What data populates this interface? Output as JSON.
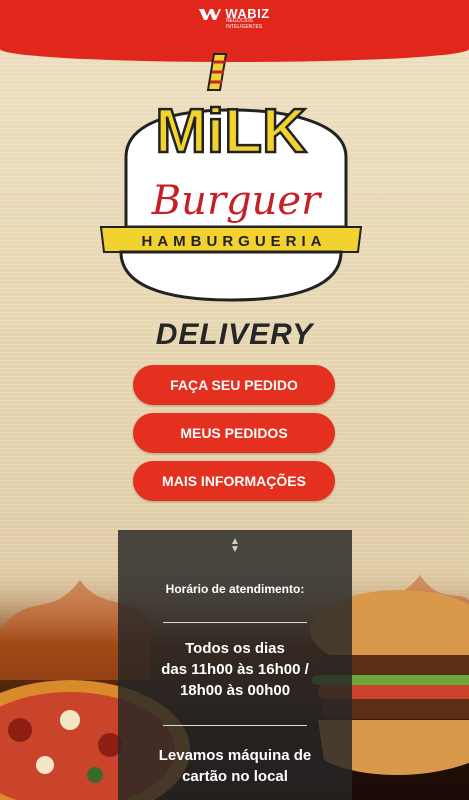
{
  "header": {
    "brand": "WABIZ",
    "brand_sub": "NEGÓCIOS INTELIGENTES"
  },
  "logo": {
    "line1": "MiLK",
    "line2": "Burguer",
    "line3": "HAMBURGUERIA"
  },
  "delivery_label": "DELIVERY",
  "buttons": {
    "order": "FAÇA SEU PEDIDO",
    "my_orders": "MEUS PEDIDOS",
    "more_info": "MAIS INFORMAÇÕES"
  },
  "info": {
    "title": "Horário de atendimento:",
    "hours_line1": "Todos os dias",
    "hours_line2": "das 11h00 às 16h00 /",
    "hours_line3": "18h00 às 00h00",
    "card_line1": "Levamos máquina de",
    "card_line2": "cartão no local"
  },
  "colors": {
    "accent": "#e3301f",
    "header": "#e1261c",
    "logo_yellow": "#f2d22e",
    "logo_red": "#c62026"
  }
}
